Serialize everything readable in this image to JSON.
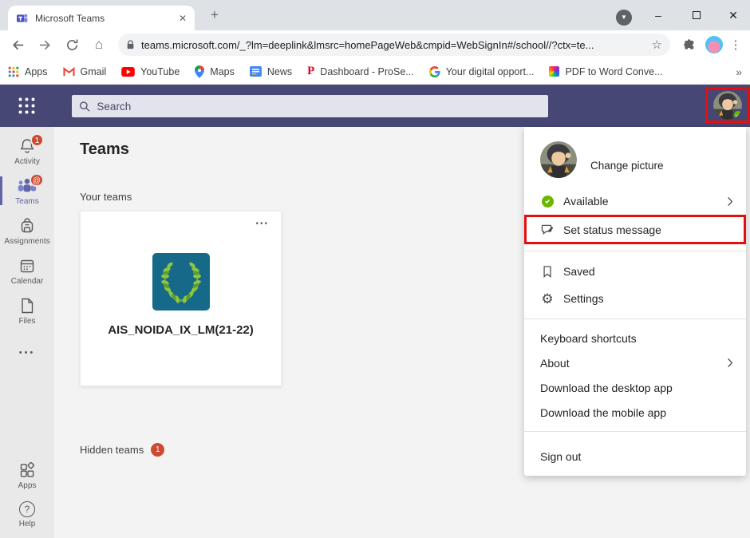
{
  "colors": {
    "teams_header_bg": "#464775",
    "teams_accent_purple": "#6264a7",
    "badge_red": "#cc4a31",
    "highlight_red": "#e30f0f",
    "available_green": "#6bb700",
    "team_logo_bg": "#17698a",
    "laurel_green": "#8dc63f"
  },
  "browser": {
    "tab_title": "Microsoft Teams",
    "tab_close": "✕",
    "new_tab": "+",
    "url": "teams.microsoft.com/_?lm=deeplink&lmsrc=homePageWeb&cmpid=WebSignIn#/school//?ctx=te...",
    "window_controls": {
      "minimize": "–",
      "close": "✕"
    },
    "bookmarks": [
      {
        "label": "Apps",
        "icon": "apps-grid-icon"
      },
      {
        "label": "Gmail",
        "icon": "gmail-icon"
      },
      {
        "label": "YouTube",
        "icon": "youtube-icon"
      },
      {
        "label": "Maps",
        "icon": "maps-pin-icon"
      },
      {
        "label": "News",
        "icon": "news-icon"
      },
      {
        "label": "Dashboard - ProSe...",
        "icon": "pinterest-icon"
      },
      {
        "label": "Your digital opport...",
        "icon": "google-g-icon"
      },
      {
        "label": "PDF to Word Conve...",
        "icon": "pdf-grid-icon"
      }
    ],
    "bookmarks_overflow": "»",
    "star": "☆",
    "more_menu": "⋮"
  },
  "teams_header": {
    "search_placeholder": "Search"
  },
  "sidebar": {
    "items": [
      {
        "label": "Activity",
        "icon": "bell-icon",
        "badge": "1"
      },
      {
        "label": "Teams",
        "icon": "teams-people-icon",
        "badge": "@",
        "selected": true
      },
      {
        "label": "Assignments",
        "icon": "backpack-icon"
      },
      {
        "label": "Calendar",
        "icon": "calendar-icon"
      },
      {
        "label": "Files",
        "icon": "file-icon"
      }
    ],
    "more_label": "•••",
    "bottom_items": [
      {
        "label": "Apps",
        "icon": "apps-tiles-icon"
      },
      {
        "label": "Help",
        "icon": "help-icon"
      }
    ]
  },
  "main": {
    "title": "Teams",
    "your_teams_label": "Your teams",
    "team_card": {
      "name": "AIS_NOIDA_IX_LM(21-22)",
      "more": "•••"
    },
    "hidden_teams_label": "Hidden teams",
    "hidden_teams_badge": "1"
  },
  "profile_menu": {
    "change_picture": "Change picture",
    "availability": "Available",
    "set_status_message": "Set status message",
    "saved": "Saved",
    "settings": "Settings",
    "keyboard_shortcuts": "Keyboard shortcuts",
    "about": "About",
    "download_desktop": "Download the desktop app",
    "download_mobile": "Download the mobile app",
    "sign_out": "Sign out"
  }
}
